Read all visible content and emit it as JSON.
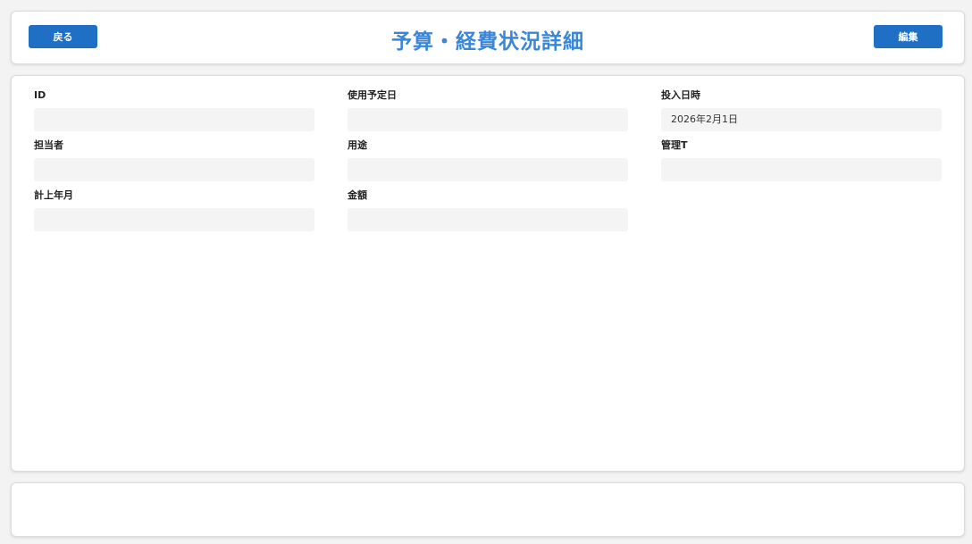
{
  "header": {
    "title": "予算・経費状況詳細",
    "back_label": "戻る",
    "edit_label": "編集"
  },
  "fields": [
    {
      "label": "ID",
      "value": ""
    },
    {
      "label": "使用予定日",
      "value": ""
    },
    {
      "label": "投入日時",
      "value": "2026年2月1日"
    },
    {
      "label": "担当者",
      "value": ""
    },
    {
      "label": "用途",
      "value": ""
    },
    {
      "label": "管理T",
      "value": ""
    },
    {
      "label": "計上年月",
      "value": ""
    },
    {
      "label": "金額",
      "value": ""
    }
  ],
  "colors": {
    "accent": "#1f6fc5",
    "title": "#3a86d8",
    "field_bg": "#f4f4f4"
  }
}
